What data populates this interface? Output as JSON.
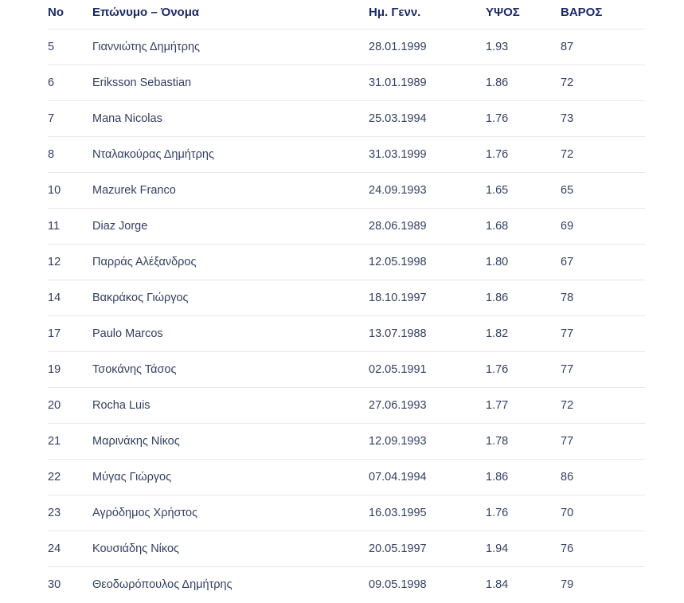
{
  "table": {
    "headers": {
      "no": "No",
      "name": "Επώνυμο – Όνομα",
      "dob": "Ημ. Γενν.",
      "height": "ΥΨΟΣ",
      "weight": "ΒΑΡΟΣ"
    },
    "rows": [
      {
        "no": "5",
        "name": "Γιαννιώτης Δημήτρης",
        "dob": "28.01.1999",
        "height": "1.93",
        "weight": "87"
      },
      {
        "no": "6",
        "name": "Eriksson Sebastian",
        "dob": "31.01.1989",
        "height": "1.86",
        "weight": "72"
      },
      {
        "no": "7",
        "name": "Mana Nicolas",
        "dob": "25.03.1994",
        "height": "1.76",
        "weight": "73"
      },
      {
        "no": "8",
        "name": "Νταλακούρας Δημήτρης",
        "dob": "31.03.1999",
        "height": "1.76",
        "weight": "72"
      },
      {
        "no": "10",
        "name": "Mazurek Franco",
        "dob": "24.09.1993",
        "height": "1.65",
        "weight": "65"
      },
      {
        "no": "11",
        "name": "Diaz Jorge",
        "dob": "28.06.1989",
        "height": "1.68",
        "weight": "69"
      },
      {
        "no": "12",
        "name": "Παρράς Αλέξανδρος",
        "dob": "12.05.1998",
        "height": "1.80",
        "weight": "67"
      },
      {
        "no": "14",
        "name": "Βακράκος Γιώργος",
        "dob": "18.10.1997",
        "height": "1.86",
        "weight": "78"
      },
      {
        "no": "17",
        "name": "Paulo Marcos",
        "dob": "13.07.1988",
        "height": "1.82",
        "weight": "77"
      },
      {
        "no": "19",
        "name": "Τσοκάνης Τάσος",
        "dob": "02.05.1991",
        "height": "1.76",
        "weight": "77"
      },
      {
        "no": "20",
        "name": "Rocha Luis",
        "dob": "27.06.1993",
        "height": "1.77",
        "weight": "72"
      },
      {
        "no": "21",
        "name": "Μαρινάκης Νίκος",
        "dob": "12.09.1993",
        "height": "1.78",
        "weight": "77"
      },
      {
        "no": "22",
        "name": "Μύγας Γιώργος",
        "dob": "07.04.1994",
        "height": "1.86",
        "weight": "86"
      },
      {
        "no": "23",
        "name": "Αγρόδημος Χρήστος",
        "dob": "16.03.1995",
        "height": "1.76",
        "weight": "70"
      },
      {
        "no": "24",
        "name": "Κουσιάδης Νίκος",
        "dob": "20.05.1997",
        "height": "1.94",
        "weight": "76"
      },
      {
        "no": "30",
        "name": "Θεοδωρόπουλος Δημήτρης",
        "dob": "09.05.1998",
        "height": "1.84",
        "weight": "79"
      }
    ]
  }
}
